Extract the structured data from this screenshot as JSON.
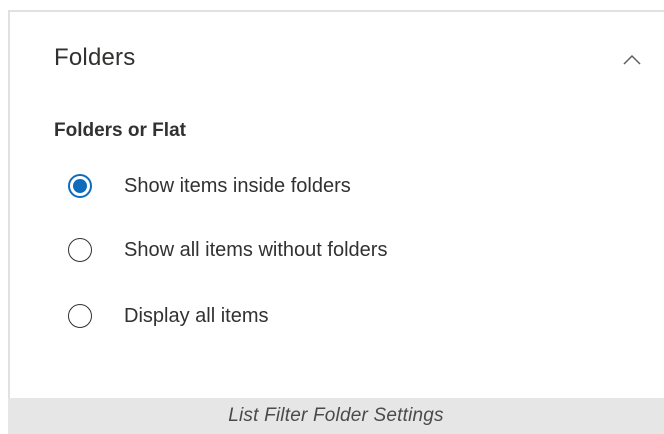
{
  "section": {
    "title": "Folders",
    "collapse_icon": "chevron-up-icon"
  },
  "group": {
    "label": "Folders or Flat",
    "options": [
      {
        "label": "Show items inside folders",
        "selected": true
      },
      {
        "label": "Show all items without folders",
        "selected": false
      },
      {
        "label": "Display all items",
        "selected": false
      }
    ]
  },
  "caption": "List Filter Folder Settings",
  "colors": {
    "accent": "#0f6cbd",
    "caption_bg": "#e6e6e6"
  }
}
